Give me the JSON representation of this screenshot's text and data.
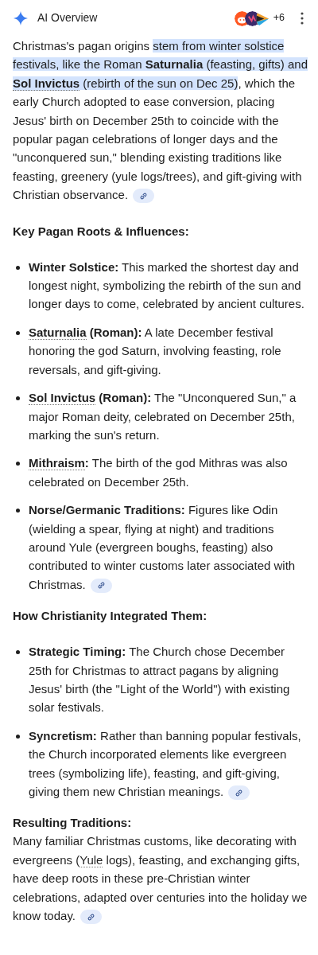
{
  "header": {
    "title": "AI Overview",
    "more_sources": "+6"
  },
  "blocks": [
    {
      "kind": "paragraph",
      "source_link": true,
      "segments": [
        {
          "kind": "plain",
          "t": "Christmas's pagan origins "
        },
        {
          "kind": "highlight",
          "t": "stem from winter solstice festivals, like the Roman **Saturnalia** (feasting, gifts) and "
        },
        {
          "kind": "highlight_term",
          "t": "**Sol Invictus**"
        },
        {
          "kind": "highlight",
          "t": " (rebirth of the sun on Dec 25)"
        },
        {
          "kind": "plain",
          "t": ", which the early Church adopted to ease conversion, placing Jesus' birth on December 25th to coincide with the popular pagan celebrations of longer days and the \"unconquered sun,\" blending existing traditions like feasting, greenery (yule logs/trees), and gift-giving with Christian observance."
        }
      ]
    },
    {
      "kind": "heading",
      "text": "Key Pagan Roots & Influences:"
    },
    {
      "kind": "list",
      "items": [
        {
          "source_link": false,
          "segments": [
            {
              "kind": "plain",
              "t": "**Winter Solstice:** This marked the shortest day and longest night, symbolizing the rebirth of the sun and longer days to come, celebrated by ancient cultures."
            }
          ]
        },
        {
          "source_link": false,
          "segments": [
            {
              "kind": "term",
              "t": "**Saturnalia**"
            },
            {
              "kind": "plain",
              "t": " **(Roman):** A late December festival honoring the god Saturn, involving feasting, role reversals, and gift-giving."
            }
          ]
        },
        {
          "source_link": false,
          "segments": [
            {
              "kind": "term",
              "t": "**Sol Invictus**"
            },
            {
              "kind": "plain",
              "t": " **(Roman):** The \"Unconquered Sun,\" a major Roman deity, celebrated on December 25th, marking the sun's return."
            }
          ]
        },
        {
          "source_link": false,
          "segments": [
            {
              "kind": "term",
              "t": "**Mithraism**"
            },
            {
              "kind": "plain",
              "t": "**:** The birth of the god Mithras was also celebrated on December 25th."
            }
          ]
        },
        {
          "source_link": true,
          "segments": [
            {
              "kind": "plain",
              "t": "**Norse/Germanic Traditions:** Figures like Odin (wielding a spear, flying at night) and traditions around Yule (evergreen boughs, feasting) also contributed to winter customs later associated with Christmas."
            }
          ]
        }
      ]
    },
    {
      "kind": "heading",
      "text": "How Christianity Integrated Them:"
    },
    {
      "kind": "list",
      "items": [
        {
          "source_link": false,
          "segments": [
            {
              "kind": "plain",
              "t": "**Strategic Timing:** The Church chose December 25th for Christmas to attract pagans by aligning Jesus' birth (the \"Light of the World\") with existing solar festivals."
            }
          ]
        },
        {
          "source_link": true,
          "segments": [
            {
              "kind": "plain",
              "t": "**Syncretism:** Rather than banning popular festivals, the Church incorporated elements like evergreen trees (symbolizing life), feasting, and gift-giving, giving them new Christian meanings."
            }
          ]
        }
      ]
    },
    {
      "kind": "subheading",
      "text": "Resulting Traditions:"
    },
    {
      "kind": "paragraph",
      "source_link": true,
      "segments": [
        {
          "kind": "plain",
          "t": "Many familiar Christmas customs, like decorating with evergreens ("
        },
        {
          "kind": "term",
          "t": "Yule"
        },
        {
          "kind": "plain",
          "t": " logs), feasting, and exchanging gifts, have deep roots in these pre-Christian winter celebrations, adapted over centuries into the holiday we know today."
        }
      ]
    }
  ]
}
